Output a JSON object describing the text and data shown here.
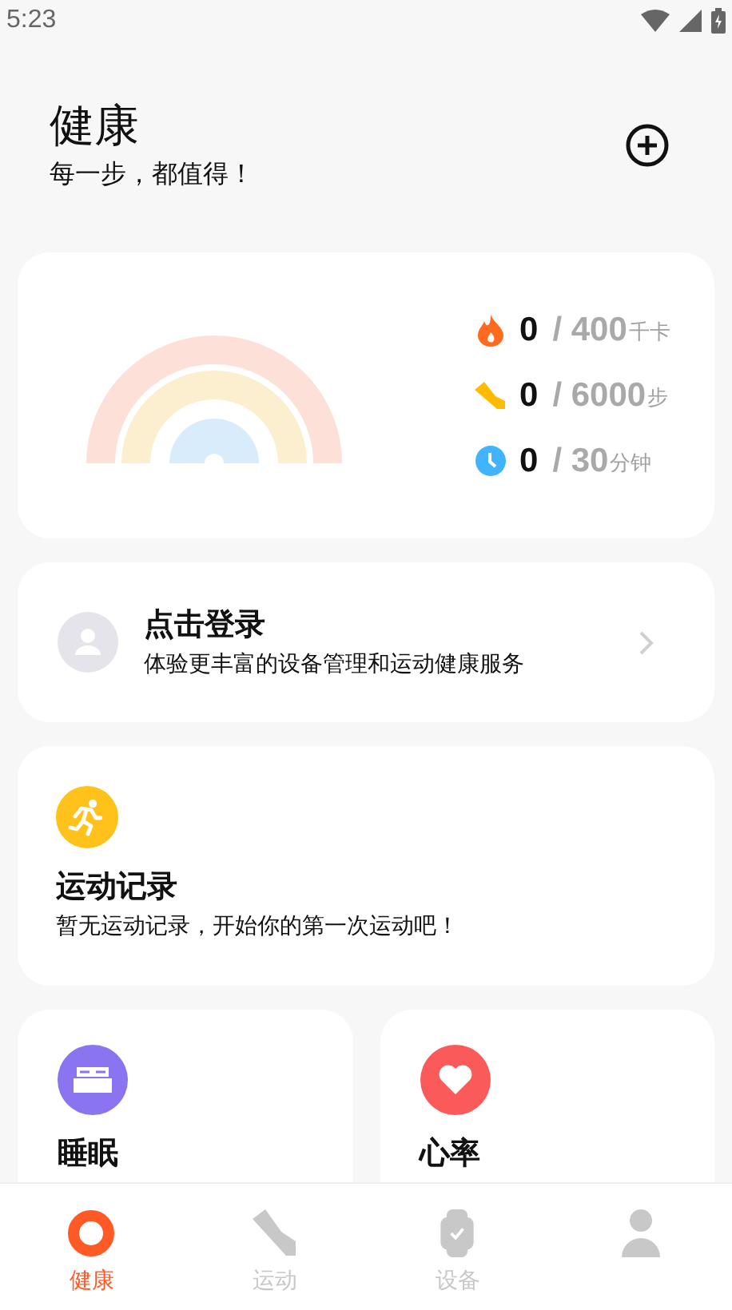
{
  "status_bar": {
    "time": "5:23"
  },
  "header": {
    "title": "健康",
    "subtitle": "每一步，都值得！"
  },
  "summary": {
    "stats": [
      {
        "kind": "calories",
        "value": "0",
        "target": "/ 400",
        "unit": "千卡"
      },
      {
        "kind": "steps",
        "value": "0",
        "target": "/ 6000",
        "unit": "步"
      },
      {
        "kind": "minutes",
        "value": "0",
        "target": "/ 30",
        "unit": "分钟"
      }
    ]
  },
  "login": {
    "title": "点击登录",
    "subtitle": "体验更丰富的设备管理和运动健康服务"
  },
  "exercise": {
    "title": "运动记录",
    "subtitle": "暂无运动记录，开始你的第一次运动吧！"
  },
  "tiles": [
    {
      "kind": "sleep",
      "title": "睡眠",
      "color": "#8a74f0"
    },
    {
      "kind": "heart",
      "title": "心率",
      "color": "#fb5a5a"
    }
  ],
  "tabs": [
    {
      "kind": "health",
      "label": "健康",
      "selected": true
    },
    {
      "kind": "exercise",
      "label": "运动",
      "selected": false
    },
    {
      "kind": "device",
      "label": "设备",
      "selected": false
    },
    {
      "kind": "profile",
      "selected": false
    }
  ]
}
